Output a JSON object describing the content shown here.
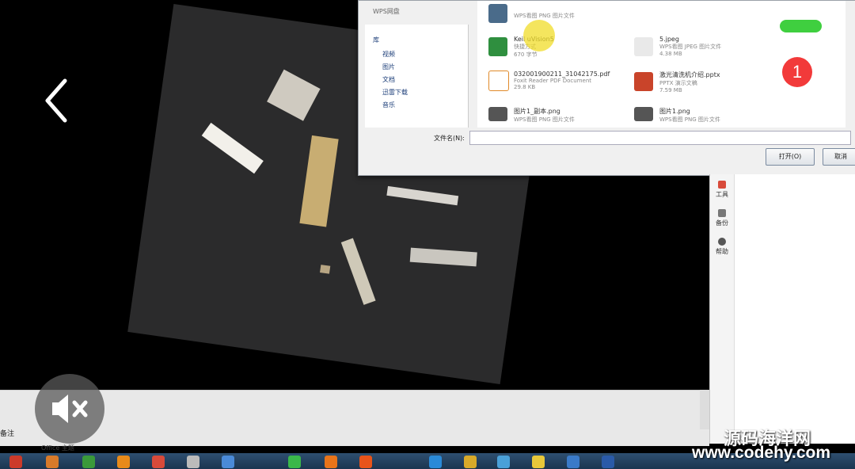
{
  "file_dialog": {
    "nav_items": [
      "WPS网盘",
      "库",
      "视频",
      "图片",
      "文档",
      "迅雷下载",
      "音乐"
    ],
    "files": [
      {
        "name": "",
        "type": "WPS看图 PNG 图片文件",
        "size": ""
      },
      {
        "name": "Keil uVision5",
        "type": "快捷方式",
        "size": "670 字节"
      },
      {
        "name": "032001900211_31042175.pdf",
        "type": "Foxit Reader PDF Document",
        "size": "29.8 KB"
      },
      {
        "name": "图片1_副本.png",
        "type": "WPS看图 PNG 图片文件",
        "size": ""
      },
      {
        "name": "",
        "type": "",
        "size": ""
      },
      {
        "name": "5.jpeg",
        "type": "WPS看图 JPEG 图片文件",
        "size": "4.38 MB"
      },
      {
        "name": "激光清洗机介绍.pptx",
        "type": "PPTX 演示文稿",
        "size": "7.59 MB"
      },
      {
        "name": "图片1.png",
        "type": "WPS看图 PNG 图片文件",
        "size": ""
      }
    ],
    "filename_label": "文件名(N):",
    "filename_value": "",
    "open_button": "打开(O)",
    "cancel_button": "取消"
  },
  "right_toolbar": {
    "items": [
      "工具",
      "备份",
      "帮助"
    ]
  },
  "bottom_pane": {
    "notes_label": "备注",
    "theme_label": "Office 主题"
  },
  "overlay": {
    "notification_count": "1",
    "watermark_cn": "源码海洋网",
    "watermark_url": "www.codehy.com"
  },
  "colors": {
    "badge": "#f23a3a",
    "battery": "#3fcf3f"
  },
  "icons": {
    "back": "chevron-left-icon",
    "share": "share-arrow-icon",
    "more": "more-dots-icon",
    "mute": "speaker-muted-icon",
    "bluetooth": "bluetooth-icon",
    "wifi": "wifi-icon",
    "signal": "signal-bars-icon",
    "charging": "charging-bolt-icon",
    "battery": "battery-icon"
  }
}
